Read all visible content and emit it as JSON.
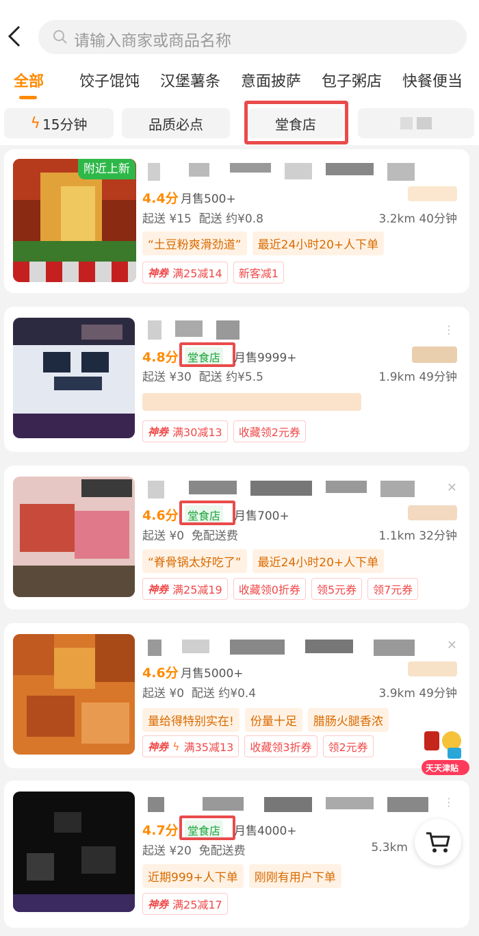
{
  "search": {
    "placeholder": "请输入商家或商品名称"
  },
  "categories": [
    "全部",
    "饺子馄饨",
    "汉堡薯条",
    "意面披萨",
    "包子粥店",
    "快餐便当"
  ],
  "filters": {
    "fast": "15分钟",
    "quality": "品质必点",
    "dinein": "堂食店"
  },
  "dinein_label": "堂食店",
  "coupon_tag": "神券",
  "float_badge": "天天津贴",
  "stores": [
    {
      "badge": "附近上新",
      "rating": "4.4分",
      "sales": "月售500+",
      "min_order": "起送 ¥15",
      "delivery": "配送 约¥0.8",
      "distance": "3.2km 40分钟",
      "highlights": [
        "“土豆粉爽滑劲道”",
        "最近24小时20+人下单"
      ],
      "promos": [
        "满25减14",
        "新客减1"
      ]
    },
    {
      "rating": "4.8分",
      "sales": "月售9999+",
      "min_order": "起送 ¥30",
      "delivery": "配送 约¥5.5",
      "distance": "1.9km 49分钟",
      "promos": [
        "满30减13",
        "收藏领2元券"
      ]
    },
    {
      "rating": "4.6分",
      "sales": "月售700+",
      "min_order": "起送 ¥0",
      "delivery": "免配送费",
      "distance": "1.1km 32分钟",
      "highlights": [
        "“脊骨锅太好吃了”",
        "最近24小时20+人下单"
      ],
      "promos": [
        "满25减19",
        "收藏领0折券",
        "领5元券",
        "领7元券"
      ]
    },
    {
      "rating": "4.6分",
      "sales": "月售5000+",
      "min_order": "起送 ¥0",
      "delivery": "配送 约¥0.4",
      "distance": "3.9km 49分钟",
      "highlights": [
        "量给得特别实在!",
        "份量十足",
        "腊肠火腿香浓"
      ],
      "promos": [
        "满35减13",
        "收藏领3折券",
        "领2元券"
      ]
    },
    {
      "rating": "4.7分",
      "sales": "月售4000+",
      "min_order": "起送 ¥20",
      "delivery": "免配送费",
      "distance": "5.3km",
      "highlights": [
        "近期999+人下单",
        "刚刚有用户下单"
      ],
      "promos": [
        "满25减17"
      ]
    }
  ]
}
